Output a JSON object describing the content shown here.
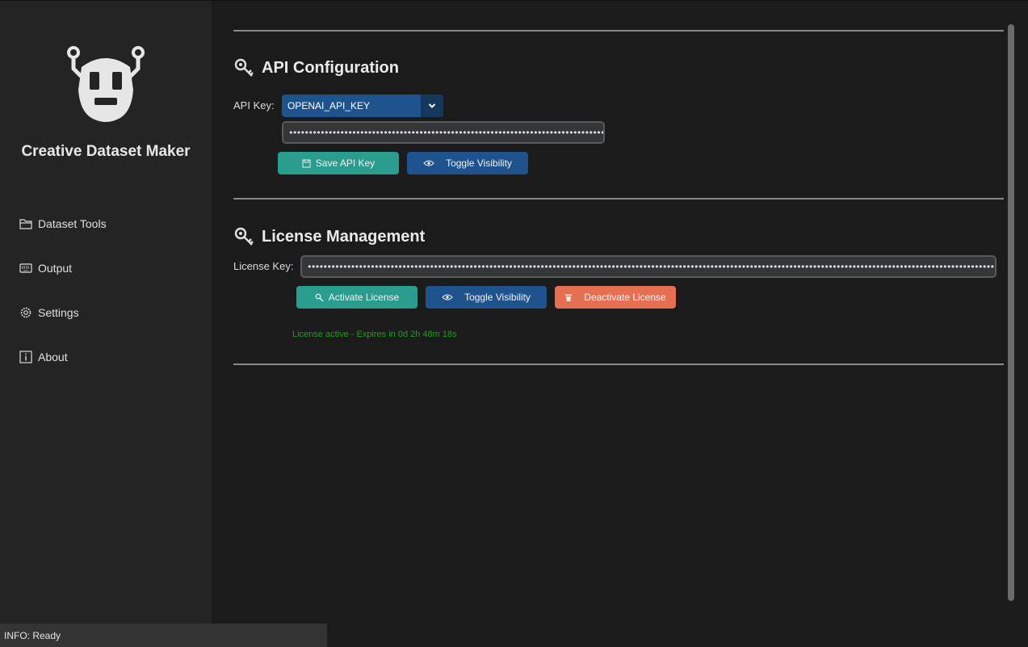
{
  "app": {
    "title": "Creative Dataset Maker"
  },
  "sidebar": {
    "items": [
      {
        "label": "Dataset Tools",
        "icon": "folder-icon"
      },
      {
        "label": "Output",
        "icon": "keyboard-icon"
      },
      {
        "label": "Settings",
        "icon": "gear-icon"
      },
      {
        "label": "About",
        "icon": "info-icon"
      }
    ]
  },
  "api_section": {
    "title": "API Configuration",
    "icon": "key-icon",
    "api_key_label": "API Key:",
    "selected_key": "OPENAI_API_KEY",
    "masked_value": "••••••••••••••••••••••••••••••••••••••••••••••••••••••••••••••••••••••••••••••••••••••••••••••••••••••••••",
    "save_button": "Save API Key",
    "toggle_button": "Toggle Visibility"
  },
  "license_section": {
    "title": "License Management",
    "icon": "key-icon",
    "license_key_label": "License Key:",
    "masked_value": "••••••••••••••••••••••••••••••••••••••••••••••••••••••••••••••••••••••••••••••••••••••••••••••••••••••••••••••••••••••••••••••••••••••••••••••••••••••••••••••••••••••••••••••",
    "activate_button": "Activate License",
    "toggle_button": "Toggle Visibility",
    "deactivate_button": "Deactivate License",
    "status": "License active - Expires in 0d 2h 48m 18s"
  },
  "statusbar": {
    "text": "INFO: Ready"
  },
  "colors": {
    "accent_blue": "#1f538d",
    "teal": "#2a9d8f",
    "orange": "#e76f51",
    "status_green": "#1fa01f"
  }
}
